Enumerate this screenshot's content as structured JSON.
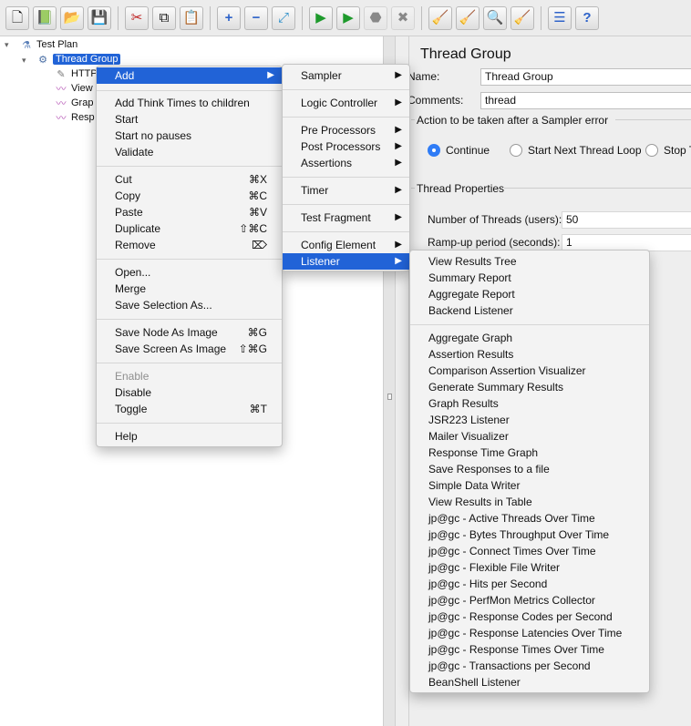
{
  "toolbar": {
    "buttons": [
      {
        "icon": "new-file-icon",
        "glyph": "🗋"
      },
      {
        "icon": "templates-icon",
        "glyph": "📗"
      },
      {
        "icon": "open-folder-icon",
        "glyph": "📂"
      },
      {
        "icon": "save-icon",
        "glyph": "💾"
      },
      {
        "icon": "cut-icon",
        "glyph": "✂"
      },
      {
        "icon": "copy-icon",
        "glyph": "⧉"
      },
      {
        "icon": "paste-icon",
        "glyph": "📋"
      },
      {
        "icon": "expand-icon",
        "glyph": "+"
      },
      {
        "icon": "collapse-icon",
        "glyph": "−"
      },
      {
        "icon": "toggle-icon",
        "glyph": "⤢"
      },
      {
        "icon": "start-icon",
        "glyph": "▶"
      },
      {
        "icon": "start-no-pauses-icon",
        "glyph": "▶"
      },
      {
        "icon": "stop-icon",
        "glyph": "⬣"
      },
      {
        "icon": "shutdown-icon",
        "glyph": "✖"
      },
      {
        "icon": "clear-icon",
        "glyph": "🧹"
      },
      {
        "icon": "clear-all-icon",
        "glyph": "🧹"
      },
      {
        "icon": "search-icon",
        "glyph": "🔍"
      },
      {
        "icon": "reset-search-icon",
        "glyph": "🧹"
      },
      {
        "icon": "function-helper-icon",
        "glyph": "☰"
      },
      {
        "icon": "help-icon",
        "glyph": "?"
      }
    ]
  },
  "tree": {
    "test_plan": "Test Plan",
    "thread_group": "Thread Group",
    "children": [
      "HTTP",
      "View",
      "Grap",
      "Resp"
    ]
  },
  "panel": {
    "title": "Thread Group",
    "name_label": "Name:",
    "name_value": "Thread Group",
    "comments_label": "Comments:",
    "comments_value": "thread",
    "error_action_title": "Action to be taken after a Sampler error",
    "radio_continue": "Continue",
    "radio_next_loop": "Start Next Thread Loop",
    "radio_stop": "Stop Thr",
    "thread_props_title": "Thread Properties",
    "num_threads_label": "Number of Threads (users):",
    "num_threads_value": "50",
    "rampup_label": "Ramp-up period (seconds):",
    "rampup_value": "1"
  },
  "context_menu": {
    "add": "Add",
    "add_think_times": "Add Think Times to children",
    "start": "Start",
    "start_no_pauses": "Start no pauses",
    "validate": "Validate",
    "cut": "Cut",
    "cut_sc": "⌘X",
    "copy": "Copy",
    "copy_sc": "⌘C",
    "paste": "Paste",
    "paste_sc": "⌘V",
    "duplicate": "Duplicate",
    "duplicate_sc": "⇧⌘C",
    "remove": "Remove",
    "remove_sc": "⌦",
    "open": "Open...",
    "merge": "Merge",
    "save_selection_as": "Save Selection As...",
    "save_node_as_image": "Save Node As Image",
    "save_node_sc": "⌘G",
    "save_screen_as_image": "Save Screen As Image",
    "save_screen_sc": "⇧⌘G",
    "enable": "Enable",
    "disable": "Disable",
    "toggle": "Toggle",
    "toggle_sc": "⌘T",
    "help": "Help"
  },
  "add_menu": {
    "sampler": "Sampler",
    "logic_controller": "Logic Controller",
    "pre_processors": "Pre Processors",
    "post_processors": "Post Processors",
    "assertions": "Assertions",
    "timer": "Timer",
    "test_fragment": "Test Fragment",
    "config_element": "Config Element",
    "listener": "Listener"
  },
  "listener_menu": {
    "group1": [
      "View Results Tree",
      "Summary Report",
      "Aggregate Report",
      "Backend Listener"
    ],
    "group2": [
      "Aggregate Graph",
      "Assertion Results",
      "Comparison Assertion Visualizer",
      "Generate Summary Results",
      "Graph Results",
      "JSR223 Listener",
      "Mailer Visualizer",
      "Response Time Graph",
      "Save Responses to a file",
      "Simple Data Writer",
      "View Results in Table",
      "jp@gc - Active Threads Over Time",
      "jp@gc - Bytes Throughput Over Time",
      "jp@gc - Connect Times Over Time",
      "jp@gc - Flexible File Writer",
      "jp@gc - Hits per Second",
      "jp@gc - PerfMon Metrics Collector",
      "jp@gc - Response Codes per Second",
      "jp@gc - Response Latencies Over Time",
      "jp@gc - Response Times Over Time",
      "jp@gc - Transactions per Second",
      "BeanShell Listener"
    ]
  }
}
